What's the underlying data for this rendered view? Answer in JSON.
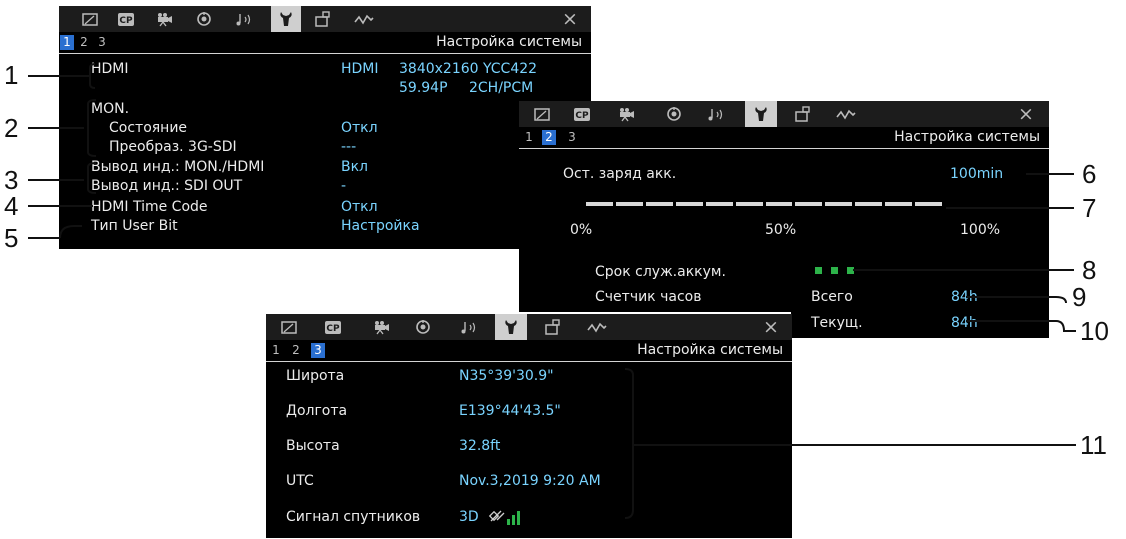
{
  "tabs": [
    {
      "icon": "frame-icon"
    },
    {
      "icon": "cp-icon",
      "text": "CP"
    },
    {
      "icon": "camera-icon"
    },
    {
      "icon": "custom-dial-icon"
    },
    {
      "icon": "audio-icon"
    },
    {
      "icon": "wrench-icon"
    },
    {
      "icon": "display-setup-icon"
    },
    {
      "icon": "waveform-icon"
    }
  ],
  "close_icon": "×",
  "colors": {
    "value_text": "#7ad4ff",
    "page_active": "#2a6fd0",
    "tab_active": "#cfcfcf",
    "battery_green": "#2db34a"
  },
  "screen1": {
    "pages": [
      "1",
      "2",
      "3"
    ],
    "active_page": 0,
    "title": "Настройка системы",
    "hdmi_label": "HDMI",
    "hdmi_value_1": "HDMI",
    "hdmi_value_2": "3840x2160 YCC422",
    "hdmi_value_3": "59.94P",
    "hdmi_value_4": "2CH/PCM",
    "mon_label": "MON.",
    "state_label": "Состояние",
    "state_value": "Откл",
    "convert_label": "Преобраз. 3G-SDI",
    "convert_value": "---",
    "out_mon_label": "Вывод инд.: MON./HDMI",
    "out_mon_value": "Вкл",
    "out_sdi_label": "Вывод инд.: SDI OUT",
    "out_sdi_value": "-",
    "timecode_label": "HDMI Time Code",
    "timecode_value": "Откл",
    "userbit_label": "Тип User Bit",
    "userbit_value": "Настройка"
  },
  "screen2": {
    "pages": [
      "1",
      "2",
      "3"
    ],
    "active_page": 1,
    "title": "Настройка системы",
    "charge_label": "Ост. заряд акк.",
    "charge_value": "100min",
    "charge_level": 1.0,
    "scale": [
      "0%",
      "50%",
      "100%"
    ],
    "life_label": "Срок служ.аккум.",
    "life_level": 3,
    "hours_label": "Счетчик часов",
    "total_label": "Всего",
    "total_value": "84h",
    "current_label": "Текущ.",
    "current_value": "84h"
  },
  "screen3": {
    "pages": [
      "1",
      "2",
      "3"
    ],
    "active_page": 2,
    "title": "Настройка системы",
    "lat_label": "Широта",
    "lat_value": "N35°39'30.9\"",
    "lon_label": "Долгота",
    "lon_value": "E139°44'43.5\"",
    "alt_label": "Высота",
    "alt_value": "32.8ft",
    "utc_label": "UTC",
    "utc_value": "Nov.3,2019 9:20 AM",
    "sat_label": "Сигнал спутников",
    "sat_value": "3D",
    "sat_icon": "satellite-signal-icon"
  },
  "callouts": [
    "1",
    "2",
    "3",
    "4",
    "5",
    "6",
    "7",
    "8",
    "9",
    "10",
    "11"
  ]
}
